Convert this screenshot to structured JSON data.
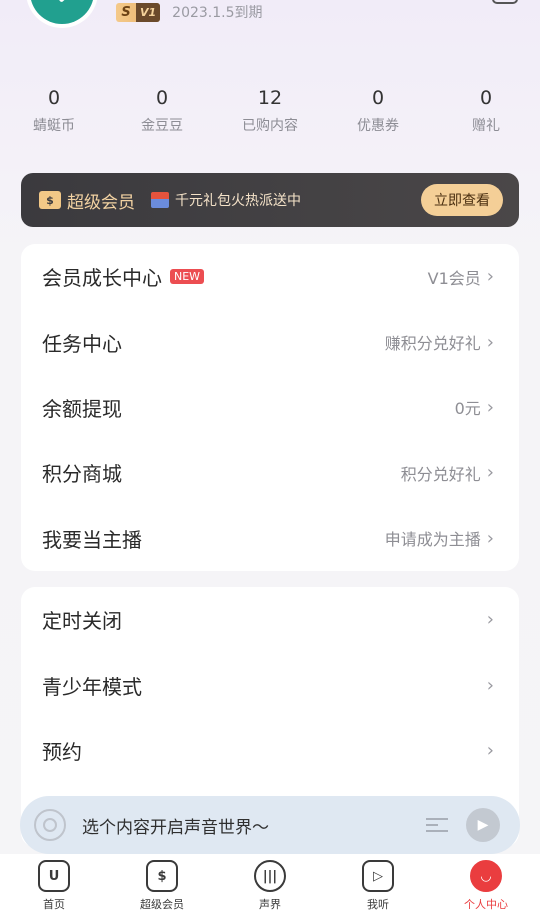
{
  "profile": {
    "vip_badge_letter": "S",
    "vip_badge_level": "V1",
    "expire_text": "2023.1.5到期"
  },
  "stats": [
    {
      "value": "0",
      "label": "蜻蜓币"
    },
    {
      "value": "0",
      "label": "金豆豆"
    },
    {
      "value": "12",
      "label": "已购内容"
    },
    {
      "value": "0",
      "label": "优惠券"
    },
    {
      "value": "0",
      "label": "赠礼"
    }
  ],
  "banner": {
    "title": "超级会员",
    "promo": "千元礼包火热派送中",
    "button": "立即查看"
  },
  "menu1": [
    {
      "label": "会员成长中心",
      "tag": "NEW",
      "value": "V1会员"
    },
    {
      "label": "任务中心",
      "tag": "",
      "value": "赚积分兑好礼"
    },
    {
      "label": "余额提现",
      "tag": "",
      "value": "0元"
    },
    {
      "label": "积分商城",
      "tag": "",
      "value": "积分兑好礼"
    },
    {
      "label": "我要当主播",
      "tag": "",
      "value": "申请成为主播"
    }
  ],
  "menu2": [
    {
      "label": "定时关闭",
      "value": ""
    },
    {
      "label": "青少年模式",
      "value": ""
    },
    {
      "label": "预约",
      "value": ""
    }
  ],
  "player": {
    "prompt": "选个内容开启声音世界～"
  },
  "tabs": [
    {
      "label": "首页",
      "icon": "home-icon",
      "active": false
    },
    {
      "label": "超级会员",
      "icon": "vip-icon",
      "active": false
    },
    {
      "label": "声界",
      "icon": "soundworld-icon",
      "active": false
    },
    {
      "label": "我听",
      "icon": "my-listen-icon",
      "active": false
    },
    {
      "label": "个人中心",
      "icon": "profile-icon",
      "active": true
    }
  ],
  "colors": {
    "accent": "#ea3d3f",
    "gold": "#f4cf97",
    "banner_bg": "#3b3a3e"
  }
}
